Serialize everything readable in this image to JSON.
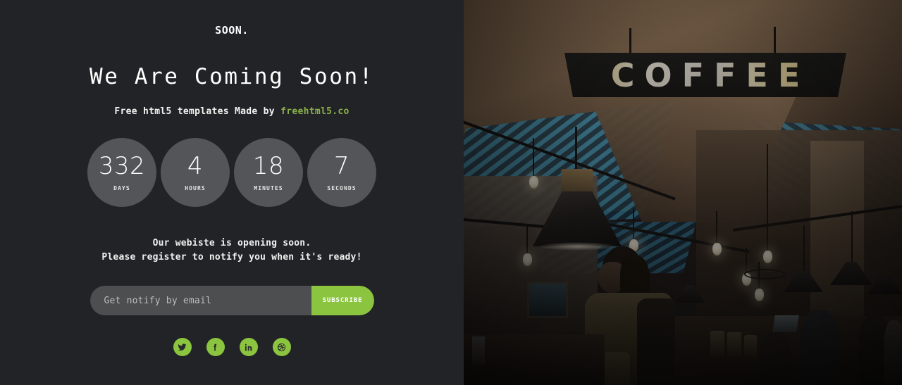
{
  "brand": {
    "logo": "SOON."
  },
  "hero": {
    "headline": "We Are Coming Soon!",
    "byline_prefix": "Free html5 templates Made by ",
    "byline_link": "freehtml5.co",
    "link_color": "#8ab04a"
  },
  "countdown": {
    "units": [
      {
        "value": "332",
        "label": "DAYS"
      },
      {
        "value": "4",
        "label": "HOURS"
      },
      {
        "value": "18",
        "label": "MINUTES"
      },
      {
        "value": "7",
        "label": "SECONDS"
      }
    ],
    "circle_color": "#545558"
  },
  "description": {
    "line1": "Our webiste is opening soon.",
    "line2": "Please register to notify you when it's ready!"
  },
  "subscribe": {
    "placeholder": "Get notify by email",
    "value": "",
    "button_label": "SUBSCRIBE",
    "accent_color": "#8bc53f",
    "field_color": "#4d4e50"
  },
  "socials": [
    {
      "name": "twitter",
      "label": "Twitter"
    },
    {
      "name": "facebook",
      "label": "Facebook"
    },
    {
      "name": "linkedin",
      "label": "LinkedIn"
    },
    {
      "name": "dribbble",
      "label": "Dribbble"
    }
  ],
  "photo": {
    "sign_text": "COFFEE",
    "scene": "dark cafe interior with skylights and pendant lamps"
  },
  "theme": {
    "background": "#222326",
    "text": "#ffffff"
  }
}
